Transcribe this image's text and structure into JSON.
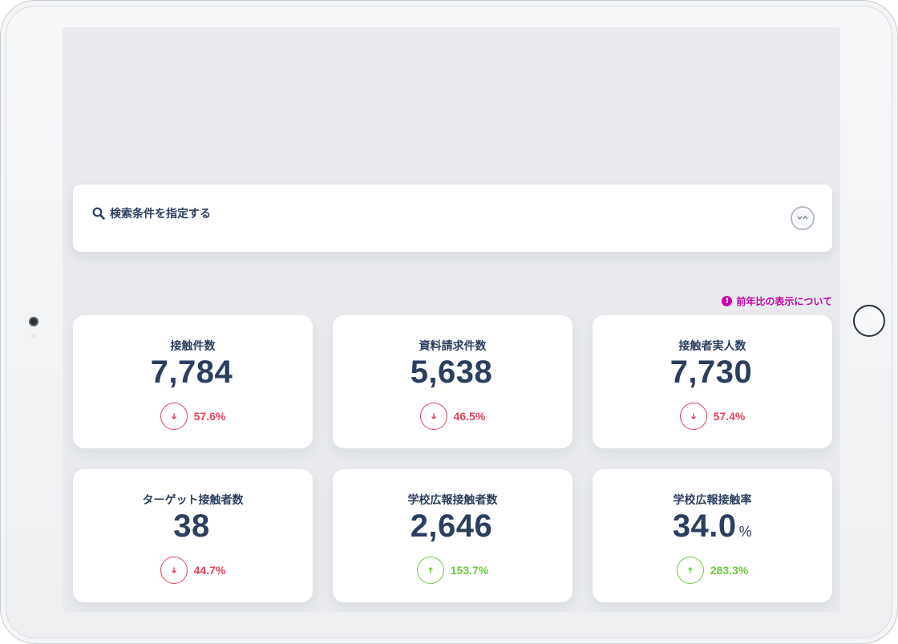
{
  "search": {
    "title": "検索条件を指定する"
  },
  "notice": {
    "label": "前年比の表示について",
    "icon": "!"
  },
  "colors": {
    "primary_text": "#2c3e5e",
    "decrease": "#e5405b",
    "increase": "#6cc93c",
    "notice": "#c400a8"
  },
  "metrics": [
    {
      "label": "接触件数",
      "value": "7,784",
      "unit": "",
      "change": "57.6%",
      "direction": "down"
    },
    {
      "label": "資料請求件数",
      "value": "5,638",
      "unit": "",
      "change": "46.5%",
      "direction": "down"
    },
    {
      "label": "接触者実人数",
      "value": "7,730",
      "unit": "",
      "change": "57.4%",
      "direction": "down"
    },
    {
      "label": "ターゲット接触者数",
      "value": "38",
      "unit": "",
      "change": "44.7%",
      "direction": "down"
    },
    {
      "label": "学校広報接触者数",
      "value": "2,646",
      "unit": "",
      "change": "153.7%",
      "direction": "up"
    },
    {
      "label": "学校広報接触率",
      "value": "34.0",
      "unit": "%",
      "change": "283.3%",
      "direction": "up"
    }
  ]
}
